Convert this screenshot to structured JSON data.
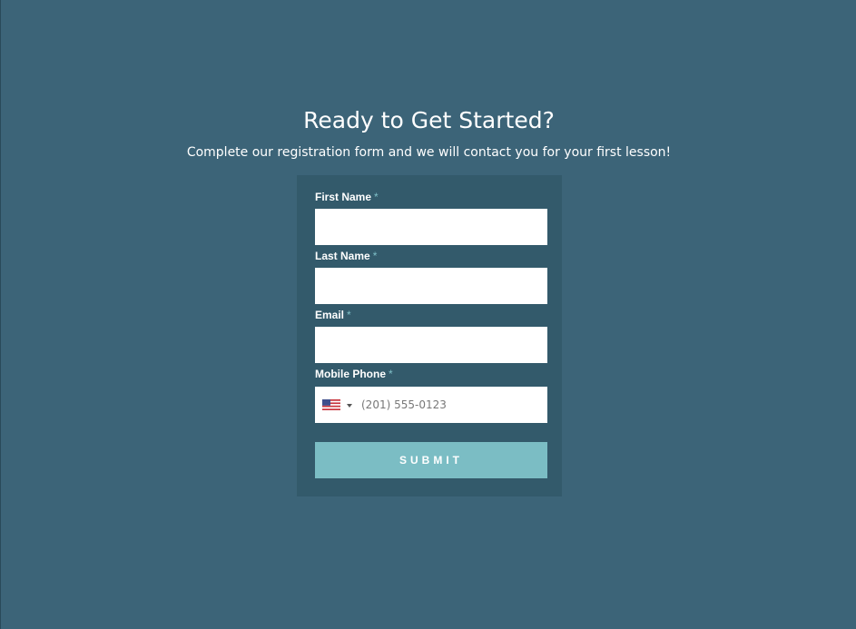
{
  "header": {
    "title": "Ready to Get Started?",
    "subtitle": "Complete our registration form and we will contact you for your first lesson!"
  },
  "form": {
    "required_marker": "*",
    "fields": {
      "first_name": {
        "label": "First Name",
        "value": ""
      },
      "last_name": {
        "label": "Last Name",
        "value": ""
      },
      "email": {
        "label": "Email",
        "value": ""
      },
      "mobile_phone": {
        "label": "Mobile Phone",
        "value": "",
        "placeholder": "(201) 555-0123",
        "country_icon": "us-flag-icon"
      }
    },
    "submit_label": "SUBMIT"
  },
  "colors": {
    "page_background": "#3c6478",
    "card_background": "#335a6b",
    "button_background": "#7bbdc4",
    "required_marker": "#7fc0c8"
  }
}
